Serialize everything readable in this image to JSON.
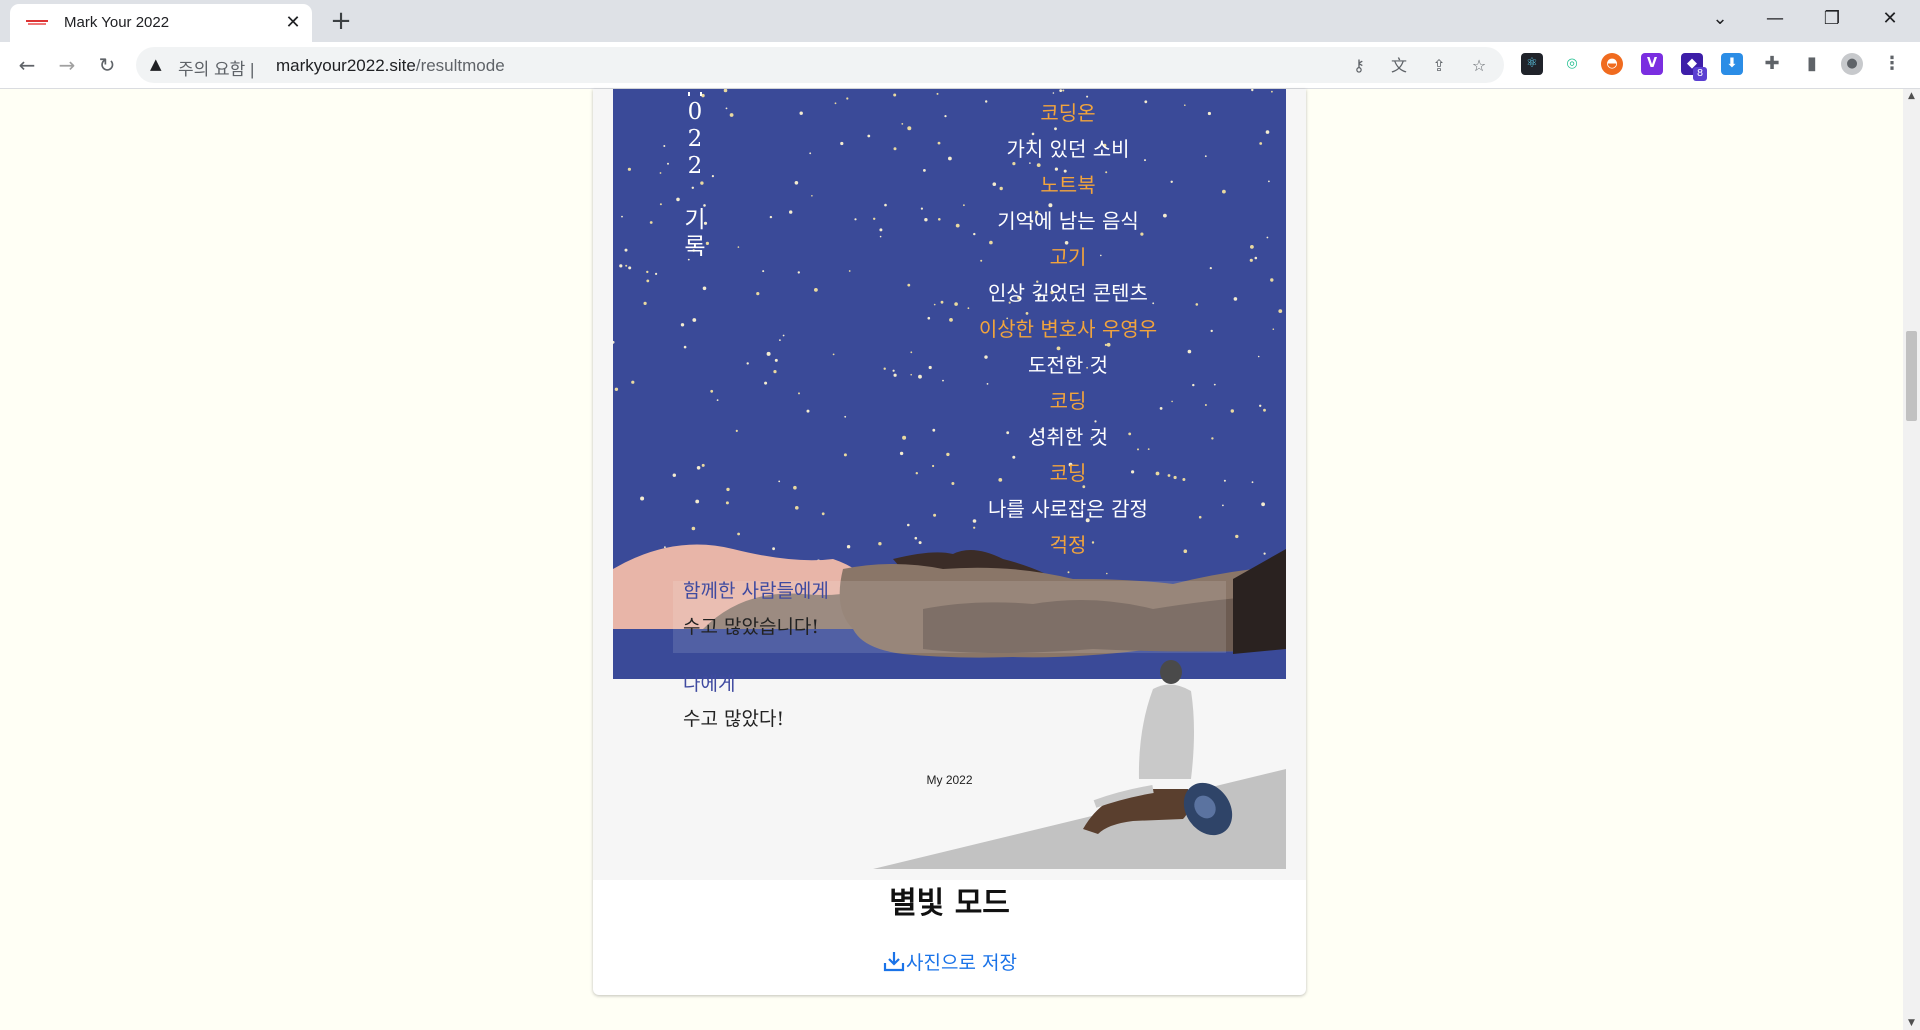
{
  "browser": {
    "tab_title": "Mark Your 2022",
    "security_label": "주의 요함",
    "url_host": "markyour2022.site",
    "url_path": "/resultmode",
    "extension_badge": "8"
  },
  "icons": {
    "back": "back-arrow-icon",
    "forward": "forward-arrow-icon",
    "reload": "reload-icon",
    "warning": "warning-triangle-icon",
    "key": "key-icon",
    "translate": "translate-icon",
    "share": "share-icon",
    "bookmark": "star-icon",
    "extensions": "puzzle-icon",
    "sidepanel": "side-panel-icon",
    "profile": "profile-icon",
    "menu": "kebab-menu-icon",
    "download": "download-icon"
  },
  "poster": {
    "vertical_text": [
      "0",
      "2",
      "2",
      "",
      "기",
      "록"
    ],
    "records": [
      {
        "text": "코딩온",
        "kind": "val"
      },
      {
        "text": "가치 있던 소비",
        "kind": "label"
      },
      {
        "text": "노트북",
        "kind": "val"
      },
      {
        "text": "기억에 남는 음식",
        "kind": "label"
      },
      {
        "text": "고기",
        "kind": "val"
      },
      {
        "text": "인상 깊었던 콘텐츠",
        "kind": "label"
      },
      {
        "text": "이상한 변호사 우영우",
        "kind": "val"
      },
      {
        "text": "도전한 것",
        "kind": "label"
      },
      {
        "text": "코딩",
        "kind": "val"
      },
      {
        "text": "성취한 것",
        "kind": "label"
      },
      {
        "text": "코딩",
        "kind": "val"
      },
      {
        "text": "나를 사로잡은 감정",
        "kind": "label"
      },
      {
        "text": "걱정",
        "kind": "val"
      }
    ],
    "to_others_label": "함께한 사람들에게",
    "to_others_message": "수고 많았습니다!",
    "to_me_label": "나에게",
    "to_me_message": "수고 많았다!",
    "footer_tag": "My 2022"
  },
  "mode_title": "별빛 모드",
  "save_label": "사진으로 저장",
  "colors": {
    "sky": "#3a4a98",
    "record_value": "#f2a43c",
    "message_to": "#3f4aa0",
    "link": "#1a73e8",
    "page_bg": "#fffff5"
  }
}
